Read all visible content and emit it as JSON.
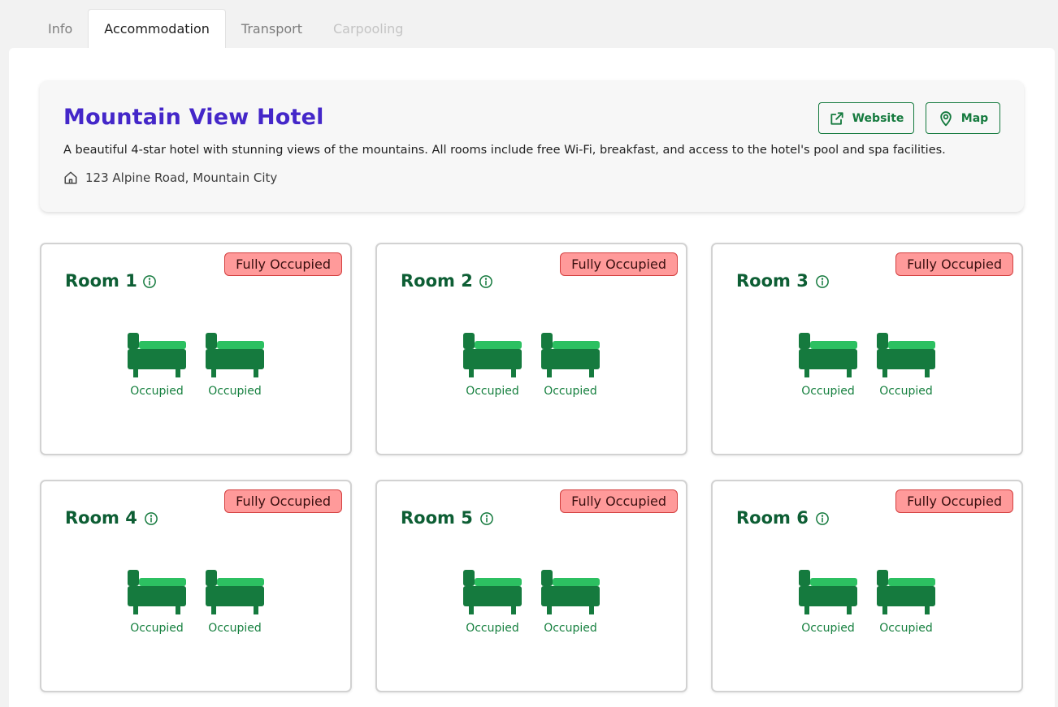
{
  "tabs": [
    {
      "label": "Info",
      "state": "normal"
    },
    {
      "label": "Accommodation",
      "state": "active"
    },
    {
      "label": "Transport",
      "state": "normal"
    },
    {
      "label": "Carpooling",
      "state": "disabled"
    }
  ],
  "hotel": {
    "name": "Mountain View Hotel",
    "description": "A beautiful 4-star hotel with stunning views of the mountains. All rooms include free Wi-Fi, breakfast, and access to the hotel's pool and spa facilities.",
    "address": "123 Alpine Road, Mountain City",
    "website_label": "Website",
    "map_label": "Map"
  },
  "rooms": [
    {
      "title": "Room 1",
      "status": "Fully Occupied",
      "beds": [
        "Occupied",
        "Occupied"
      ]
    },
    {
      "title": "Room 2",
      "status": "Fully Occupied",
      "beds": [
        "Occupied",
        "Occupied"
      ]
    },
    {
      "title": "Room 3",
      "status": "Fully Occupied",
      "beds": [
        "Occupied",
        "Occupied"
      ]
    },
    {
      "title": "Room 4",
      "status": "Fully Occupied",
      "beds": [
        "Occupied",
        "Occupied"
      ]
    },
    {
      "title": "Room 5",
      "status": "Fully Occupied",
      "beds": [
        "Occupied",
        "Occupied"
      ]
    },
    {
      "title": "Room 6",
      "status": "Fully Occupied",
      "beds": [
        "Occupied",
        "Occupied"
      ]
    }
  ],
  "icons": {
    "website": "external-link-icon",
    "map": "map-pin-icon",
    "address": "home-icon",
    "room_info": "info-circle-icon",
    "bed": "bed-icon"
  },
  "colors": {
    "hotel_name": "#4427c9",
    "accent_green": "#157a3e",
    "room_title": "#0d5e34",
    "badge_bg": "#ff9a9a",
    "badge_border": "#d33f3f"
  }
}
